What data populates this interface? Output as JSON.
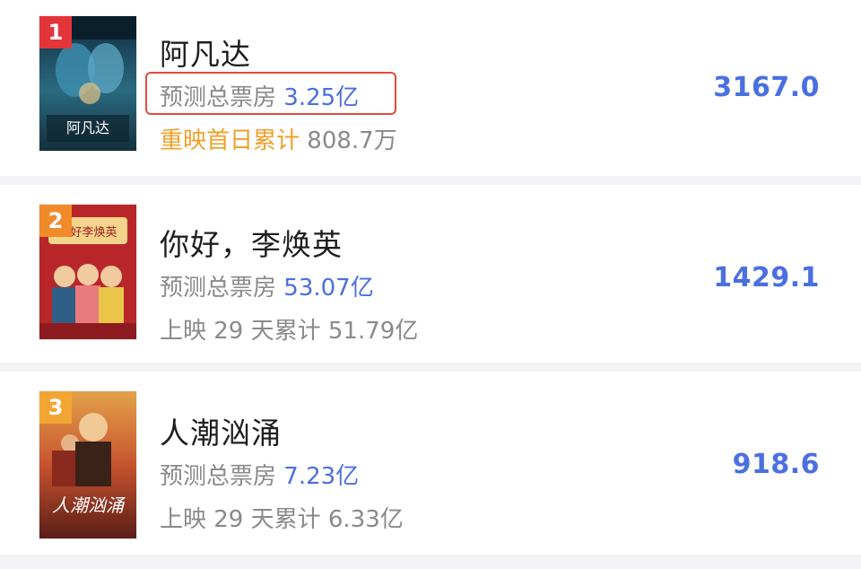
{
  "list": {
    "items": [
      {
        "rank": "1",
        "title": "阿凡达",
        "forecast_label": "预测总票房",
        "forecast_value": "3.25亿",
        "accum_label": "重映首日累计",
        "accum_value": "808.7万",
        "score": "3167.0",
        "rank_color": "#e3343a"
      },
      {
        "rank": "2",
        "title": "你好，李焕英",
        "forecast_label": "预测总票房",
        "forecast_value": "53.07亿",
        "accum_label": "上映 29 天累计",
        "accum_value": "51.79亿",
        "score": "1429.1",
        "rank_color": "#f08a2a"
      },
      {
        "rank": "3",
        "title": "人潮汹涌",
        "forecast_label": "预测总票房",
        "forecast_value": "7.23亿",
        "accum_label": "上映 29 天累计",
        "accum_value": "6.33亿",
        "score": "918.6",
        "rank_color": "#f3a534"
      }
    ]
  },
  "colors": {
    "accent_blue": "#4a6fe0",
    "highlight_red": "#e5483c",
    "rerelease_orange": "#f0a02a"
  }
}
